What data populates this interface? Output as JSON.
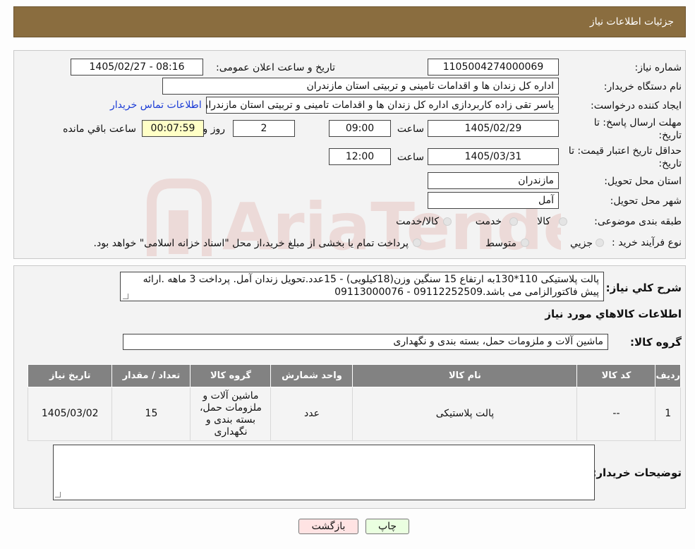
{
  "header": {
    "title": "جزئیات اطلاعات نیاز"
  },
  "watermark": {
    "text": "AriaTender.neT",
    "color": "#c0392b"
  },
  "form": {
    "need_number_label": "شماره نیاز:",
    "need_number": "1105004274000069",
    "announce_label": "تاریخ و ساعت اعلان عمومی:",
    "announce_value": "1405/02/27 - 08:16",
    "buyer_org_label": "نام دستگاه خریدار:",
    "buyer_org": "اداره کل زندان ها و اقدامات تامینی و تربیتی استان مازندران",
    "requester_label": "ایجاد کننده درخواست:",
    "requester": "یاسر تقی زاده کاربردازی اداره کل زندان ها و اقدامات تامینی و تربیتی استان مازندران",
    "contact_link": "اطلاعات تماس خریدار",
    "deadline_label": "مهلت ارسال پاسخ: تا",
    "deadline_label2": "تاریخ:",
    "deadline_date": "1405/02/29",
    "time_label": "ساعت",
    "deadline_time": "09:00",
    "days_value": "2",
    "days_label": "روز و",
    "remaining_time": "00:07:59",
    "remaining_label": "ساعت باقي مانده",
    "validity_label": "حداقل تاریخ اعتبار قیمت: تا",
    "validity_label2": "تاریخ:",
    "validity_date": "1405/03/31",
    "validity_time": "12:00",
    "province_label": "استان محل تحویل:",
    "province": "مازندران",
    "city_label": "شهر محل تحویل:",
    "city": "آمل",
    "category_label": "طبقه بندی موضوعی:",
    "category_options": [
      "کالا",
      "خدمت",
      "کالا/خدمت"
    ],
    "process_label": "نوع فرآیند خرید :",
    "process_options": [
      "جزیي",
      "متوسط"
    ],
    "process_note": "پرداخت تمام یا بخشی از مبلغ خرید،از محل \"اسناد خزانه اسلامی\" خواهد بود."
  },
  "summary": {
    "label": "شرح کلي نیاز:",
    "text_line1": "پالت پلاستیکی 110*130به ارتفاع 15 سنگین وزن(18کیلویی) - 15عدد.تحویل زندان آمل. پرداخت 3 ماهه .ارائه",
    "text_line2": "پیش فاکتورالزامی می باشد.09112252509 - 09113000076"
  },
  "goods": {
    "section_title": "اطلاعات کالاهاي مورد نیاز",
    "group_label": "گروه کالا:",
    "group_value": "ماشین آلات و ملزومات حمل، بسته بندی و نگهداری"
  },
  "table": {
    "headers": [
      "ردیف",
      "کد کالا",
      "نام کالا",
      "واحد شمارش",
      "گروه کالا",
      "تعداد / مقدار",
      "تاریخ نیاز"
    ],
    "rows": [
      [
        "1",
        "--",
        "پالت پلاستیکی",
        "عدد",
        "ماشین آلات و ملزومات حمل، بسته بندی و نگهداری",
        "15",
        "1405/03/02"
      ]
    ]
  },
  "buyer_notes": {
    "label": "توضیحات خریدار:",
    "value": ""
  },
  "buttons": {
    "print": "چاپ",
    "back": "بازگشت"
  }
}
